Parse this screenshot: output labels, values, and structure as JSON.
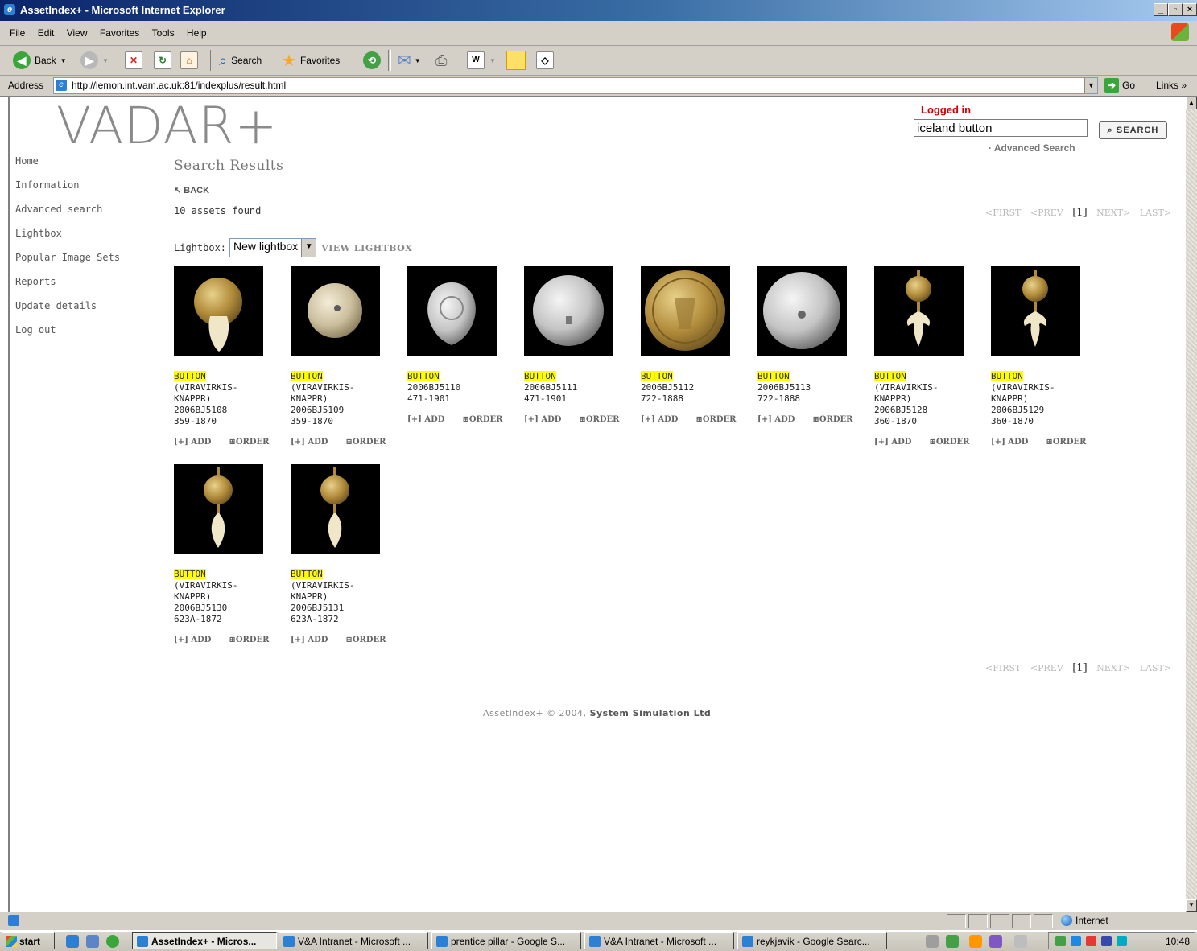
{
  "window": {
    "title": "AssetIndex+ - Microsoft Internet Explorer"
  },
  "menu": [
    "File",
    "Edit",
    "View",
    "Favorites",
    "Tools",
    "Help"
  ],
  "toolbar": {
    "back": "Back",
    "search": "Search",
    "favorites": "Favorites"
  },
  "address": {
    "label": "Address",
    "url": "http://lemon.int.vam.ac.uk:81/indexplus/result.html",
    "go": "Go",
    "links": "Links"
  },
  "site": {
    "logo": "VADAR+",
    "logged_in": "Logged in",
    "search_value": "iceland button",
    "search_button": "SEARCH",
    "advanced_link": "· Advanced Search"
  },
  "nav": [
    "Home",
    "Information",
    "Advanced search",
    "Lightbox",
    "Popular Image Sets",
    "Reports",
    "Update details",
    "Log out"
  ],
  "results": {
    "heading": "Search Results",
    "back": "BACK",
    "count": "10 assets found",
    "pager": {
      "first": "<FIRST",
      "prev": "<PREV",
      "current": "[1]",
      "next": "NEXT>",
      "last": "LAST>"
    },
    "lightbox_label": "Lightbox:",
    "lightbox_value": "New lightbox",
    "view_lightbox": "VIEW LIGHTBOX",
    "add_label": "[+] ADD",
    "order_label": "ORDER",
    "items": [
      {
        "title": "BUTTON",
        "lines": [
          "(VIRAVIRKIS-",
          "KNAPPR)",
          "2006BJ5108",
          "359-1870"
        ],
        "image": "filigree-button-with-leaf-pendant",
        "tone": "gold"
      },
      {
        "title": "BUTTON",
        "lines": [
          "(VIRAVIRKIS-",
          "KNAPPR)",
          "2006BJ5109",
          "359-1870"
        ],
        "image": "button-reverse-shank",
        "tone": "pale"
      },
      {
        "title": "BUTTON",
        "lines": [
          "2006BJ5110",
          "471-1901"
        ],
        "image": "silver-filigree-button",
        "tone": "silver"
      },
      {
        "title": "BUTTON",
        "lines": [
          "2006BJ5111",
          "471-1901"
        ],
        "image": "silver-button-reverse",
        "tone": "silver"
      },
      {
        "title": "BUTTON",
        "lines": [
          "2006BJ5112",
          "722-1888"
        ],
        "image": "gilt-embossed-button",
        "tone": "gold"
      },
      {
        "title": "BUTTON",
        "lines": [
          "2006BJ5113",
          "722-1888"
        ],
        "image": "silver-button-reverse-stamped",
        "tone": "silver"
      },
      {
        "title": "BUTTON",
        "lines": [
          "(VIRAVIRKIS-",
          "KNAPPR)",
          "2006BJ5128",
          "360-1870"
        ],
        "image": "ball-button-with-fleur-pendant",
        "tone": "gold"
      },
      {
        "title": "BUTTON",
        "lines": [
          "(VIRAVIRKIS-",
          "KNAPPR)",
          "2006BJ5129",
          "360-1870"
        ],
        "image": "ball-button-with-fleur-pendant",
        "tone": "gold"
      },
      {
        "title": "BUTTON",
        "lines": [
          "(VIRAVIRKIS-",
          "KNAPPR)",
          "2006BJ5130",
          "623A-1872"
        ],
        "image": "ball-button-with-leaf-pendant",
        "tone": "gold"
      },
      {
        "title": "BUTTON",
        "lines": [
          "(VIRAVIRKIS-",
          "KNAPPR)",
          "2006BJ5131",
          "623A-1872"
        ],
        "image": "ball-button-with-leaf-pendant",
        "tone": "gold"
      }
    ]
  },
  "footer": {
    "text": "AssetIndex+ © 2004,",
    "company": "System Simulation Ltd"
  },
  "status": {
    "zone": "Internet"
  },
  "taskbar": {
    "start": "start",
    "tasks": [
      "AssetIndex+ - Micros...",
      "V&A Intranet - Microsoft ...",
      "prentice pillar - Google S...",
      "V&A Intranet - Microsoft ...",
      "reykjavik - Google Searc..."
    ],
    "clock": "10:48"
  }
}
